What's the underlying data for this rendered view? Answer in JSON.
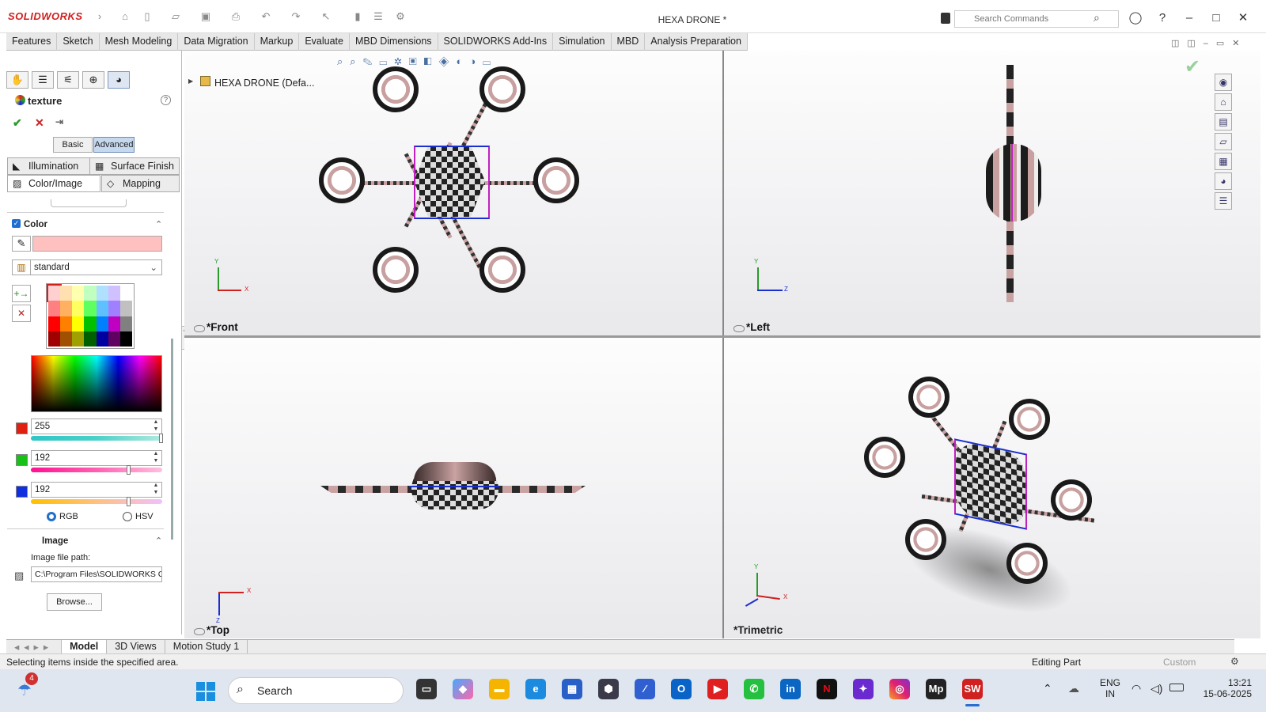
{
  "app": {
    "logo": "SOLIDWORKS",
    "doc_title": "HEXA DRONE *"
  },
  "search": {
    "placeholder": "Search Commands"
  },
  "menu_tabs": [
    "Features",
    "Sketch",
    "Mesh Modeling",
    "Data Migration",
    "Markup",
    "Evaluate",
    "MBD Dimensions",
    "SOLIDWORKS Add-Ins",
    "Simulation",
    "MBD",
    "Analysis Preparation"
  ],
  "panel": {
    "title": "texture",
    "basic": "Basic",
    "advanced": "Advanced",
    "tabs": {
      "illumination": "Illumination",
      "surface_finish": "Surface Finish",
      "color_image": "Color/Image",
      "mapping": "Mapping"
    },
    "color_section": "Color",
    "color_swatch": "#ffc0c0",
    "palette": "standard",
    "rgb": {
      "r": "255",
      "g": "192",
      "b": "192"
    },
    "rgb_fraction": {
      "r": 1.0,
      "g": 0.753,
      "b": 0.753
    },
    "mode_rgb": "RGB",
    "mode_hsv": "HSV",
    "image_section": "Image",
    "image_path_label": "Image file path:",
    "image_path": "C:\\Program Files\\SOLIDWORKS C",
    "browse": "Browse..."
  },
  "tree": {
    "root": "HEXA DRONE  (Defa..."
  },
  "viewports": {
    "front": "*Front",
    "left": "*Left",
    "top": "*Top",
    "trimetric": "*Trimetric"
  },
  "axes": {
    "x": "X",
    "y": "Y",
    "z": "Z"
  },
  "bottom_tabs": [
    "Model",
    "3D Views",
    "Motion Study 1"
  ],
  "status": {
    "left": "Selecting items inside the specified area.",
    "editing": "Editing Part",
    "custom": "Custom"
  },
  "taskbar": {
    "search": "Search",
    "lang": "ENG",
    "region": "IN",
    "time": "13:21",
    "date": "15-06-2025",
    "badge": "4"
  },
  "colors": {
    "accent": "#d02020",
    "selection": "#1a2fd0",
    "highlight": "#c020c0"
  }
}
